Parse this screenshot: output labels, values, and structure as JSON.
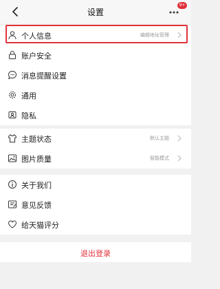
{
  "header": {
    "title": "设置",
    "badge": "9+"
  },
  "group1": [
    {
      "label": "个人信息",
      "value": "编辑地址管理",
      "icon": "person-icon"
    },
    {
      "label": "账户安全",
      "icon": "lock-icon"
    },
    {
      "label": "消息提醒设置",
      "icon": "chat-icon"
    },
    {
      "label": "通用",
      "icon": "gear-icon"
    },
    {
      "label": "隐私",
      "icon": "privacy-icon"
    }
  ],
  "group2": [
    {
      "label": "主题状态",
      "value": "默认主题",
      "icon": "shirt-icon"
    },
    {
      "label": "图片质量",
      "value": "智能模式",
      "icon": "image-icon"
    }
  ],
  "group3": [
    {
      "label": "关于我们",
      "icon": "info-icon"
    },
    {
      "label": "意见反馈",
      "icon": "feedback-icon"
    },
    {
      "label": "给天猫评分",
      "icon": "heart-icon"
    }
  ],
  "logout": "退出登录",
  "colors": {
    "accent": "#e0313a",
    "background": "#f1f1f1"
  }
}
